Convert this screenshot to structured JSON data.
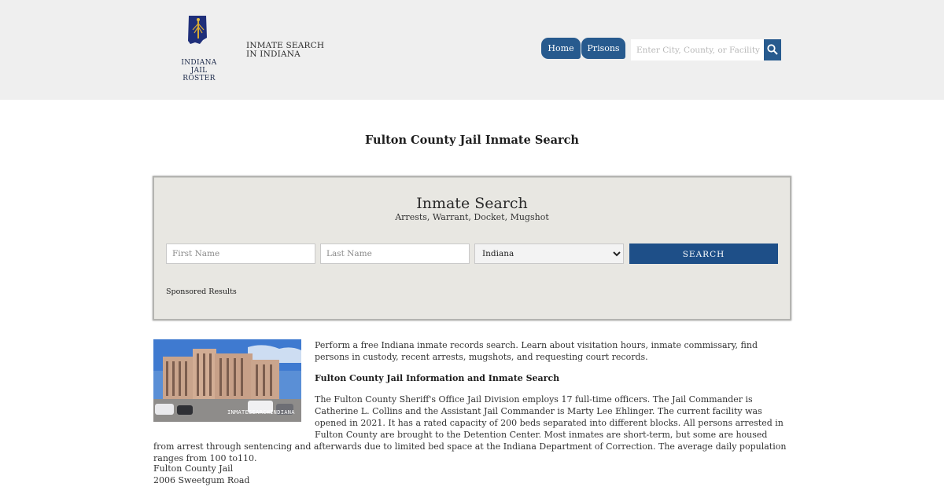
{
  "header": {
    "logo_line1": "INDIANA",
    "logo_line2": "JAIL ROSTER",
    "tagline": "INMATE SEARCH IN INDIANA",
    "nav": {
      "home": "Home",
      "prisons": "Prisons"
    },
    "search_placeholder": "Enter City, County, or Facility"
  },
  "page_title": "Fulton County Jail Inmate Search",
  "search_panel": {
    "title": "Inmate Search",
    "subtitle": "Arrests, Warrant, Docket, Mugshot",
    "first_name_placeholder": "First Name",
    "last_name_placeholder": "Last Name",
    "state_selected": "Indiana",
    "search_label": "SEARCH",
    "sponsored": "Sponsored Results"
  },
  "photo": {
    "watermark": "INMATESEARCHINDIANA"
  },
  "content": {
    "intro": "Perform a free Indiana inmate records search. Learn about visitation hours, inmate commissary, find persons in custody, recent arrests, mugshots, and requesting court records.",
    "subhead": "Fulton County Jail Information and Inmate Search",
    "body": "The Fulton County Sheriff's Office Jail Division employs 17 full-time officers. The Jail Commander is Catherine L. Collins and the Assistant Jail Commander is Marty Lee Ehlinger. The current facility was opened in 2021. It has a rated capacity of 200 beds separated into different blocks. All persons arrested in Fulton County are brought to the Detention Center. Most inmates are short-term, but some are housed from arrest through sentencing and afterwards due to limited bed space at the Indiana Department of Correction. The average daily population ranges from 100 to110."
  },
  "address": {
    "line1": "Fulton County Jail",
    "line2": "2006 Sweetgum Road"
  },
  "colors": {
    "header_bg": "#efefef",
    "accent": "#275a8e",
    "panel_bg": "#e8e7e2",
    "search_btn": "#1e4f88"
  }
}
